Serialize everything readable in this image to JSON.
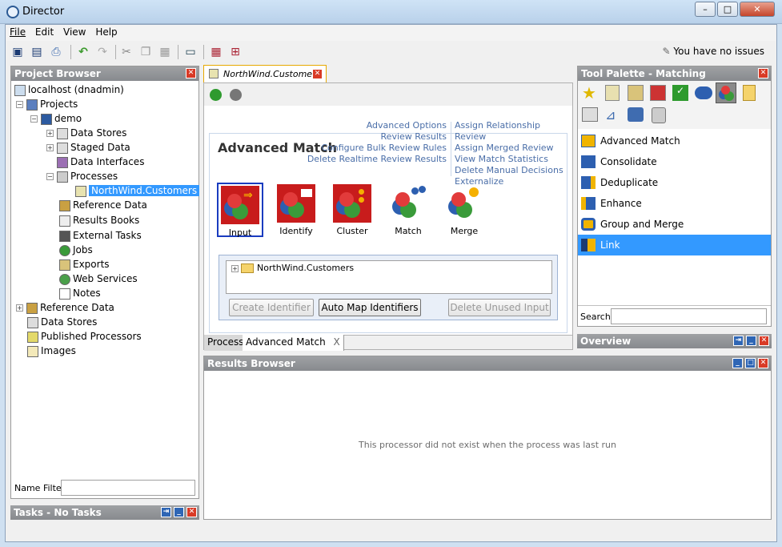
{
  "window": {
    "title": "Director",
    "min": "–",
    "max": "□",
    "close": "✕"
  },
  "menu": [
    {
      "label": "File"
    },
    {
      "label": "Edit"
    },
    {
      "label": "View"
    },
    {
      "label": "Help"
    }
  ],
  "toolbar": {
    "issues": "You have no issues",
    "icons": [
      "save-icon",
      "save-all-icon",
      "print-icon",
      "undo-icon",
      "redo-icon",
      "cut-icon",
      "copy-icon",
      "paste-icon",
      "window-icon",
      "calendar-icon",
      "scheduler-icon"
    ]
  },
  "project_browser": {
    "title": "Project Browser",
    "close": "✕",
    "tree": {
      "server": "localhost (dnadmin)",
      "projects": "Projects",
      "demo": "demo",
      "data_stores": "Data Stores",
      "staged_data": "Staged Data",
      "data_interfaces": "Data Interfaces",
      "processes": "Processes",
      "process_item": "NorthWind.Customers",
      "reference_data": "Reference Data",
      "results_books": "Results Books",
      "external_tasks": "External Tasks",
      "jobs": "Jobs",
      "exports": "Exports",
      "web_services": "Web Services",
      "notes": "Notes",
      "root_reference_data": "Reference Data",
      "root_data_stores": "Data Stores",
      "published_processors": "Published Processors",
      "images": "Images"
    },
    "filter_label": "Name Filter",
    "filter_value": ""
  },
  "tasks": {
    "title": "Tasks - No Tasks"
  },
  "editor": {
    "tab_title": "NorthWind.Customers",
    "tab_close": "✕",
    "heading": "Advanced Match",
    "links_left": [
      "Advanced Options",
      "Review Results",
      "Configure Bulk Review Rules",
      "Delete Realtime Review Results"
    ],
    "links_right": [
      "Assign Relationship Review",
      "Assign Merged Review",
      "View Match Statistics",
      "Delete Manual Decisions",
      "Externalize"
    ],
    "processors": [
      "Input",
      "Identify",
      "Cluster",
      "Match",
      "Merge"
    ],
    "input_item": "NorthWind.Customers",
    "buttons": {
      "create": "Create Identifier",
      "automap": "Auto Map Identifiers",
      "delete": "Delete Unused Input"
    },
    "bottom_tabs": {
      "process": "Process",
      "advanced": "Advanced Match",
      "advanced_close": "X"
    }
  },
  "results_browser": {
    "title": "Results Browser",
    "message": "This processor did not exist when the process was last run"
  },
  "tool_palette": {
    "title": "Tool Palette - Matching",
    "items": [
      "Advanced Match",
      "Consolidate",
      "Deduplicate",
      "Enhance",
      "Group and Merge",
      "Link"
    ],
    "selected": "Link",
    "search_label": "Search",
    "search_value": ""
  },
  "overview": {
    "title": "Overview"
  },
  "colors": {
    "accent": "#3399ff",
    "panel_header": "#8f9295",
    "link": "#4a6ea8",
    "close_red": "#d93a26"
  }
}
